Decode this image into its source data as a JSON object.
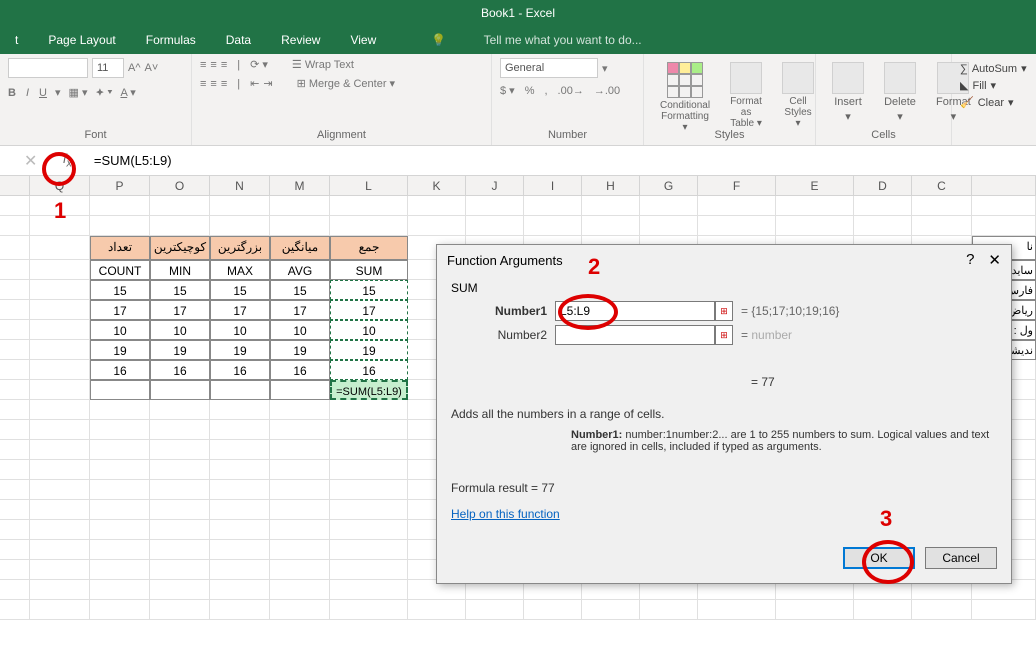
{
  "app": {
    "title": "Book1 - Excel"
  },
  "tabs": {
    "t1": "t",
    "page_layout": "Page Layout",
    "formulas": "Formulas",
    "data": "Data",
    "review": "Review",
    "view": "View",
    "tell_me": "Tell me what you want to do..."
  },
  "ribbon": {
    "font_size": "11",
    "font_group": "Font",
    "alignment_group": "Alignment",
    "wrap_text": "Wrap Text",
    "merge_center": "Merge & Center",
    "number_group": "Number",
    "number_format": "General",
    "styles_group": "Styles",
    "cond_format": "Conditional\nFormatting",
    "format_table": "Format as\nTable",
    "cell_styles": "Cell\nStyles",
    "cells_group": "Cells",
    "insert": "Insert",
    "delete": "Delete",
    "format": "Format",
    "autosum": "AutoSum",
    "fill": "Fill",
    "clear": "Clear"
  },
  "formula_bar": {
    "value": "=SUM(L5:L9)"
  },
  "columns": [
    "Q",
    "P",
    "O",
    "N",
    "M",
    "L",
    "K",
    "J",
    "I",
    "H",
    "G",
    "F",
    "E",
    "D",
    "C"
  ],
  "headers_fa": {
    "count": "تعداد",
    "min": "کوچیکترین",
    "max": "بزرگترین",
    "avg": "میانگین",
    "sum": "جمع"
  },
  "headers_en": {
    "count": "COUNT",
    "min": "MIN",
    "max": "MAX",
    "avg": "AVG",
    "sum": "SUM"
  },
  "data_rows": [
    {
      "p": "15",
      "o": "15",
      "n": "15",
      "m": "15",
      "l": "15"
    },
    {
      "p": "17",
      "o": "17",
      "n": "17",
      "m": "17",
      "l": "17"
    },
    {
      "p": "10",
      "o": "10",
      "n": "10",
      "m": "10",
      "l": "10"
    },
    {
      "p": "19",
      "o": "19",
      "n": "19",
      "m": "19",
      "l": "19"
    },
    {
      "p": "16",
      "o": "16",
      "n": "16",
      "m": "16",
      "l": "16"
    }
  ],
  "sum_formula": "=SUM(L5:L9)",
  "rtl_cells": {
    "r0": "نا",
    "r1": "ساید",
    "r2": "فارس",
    "r3": "رياض",
    "r4": "ول :",
    "r5": "نديشا"
  },
  "dialog": {
    "title": "Function Arguments",
    "func": "SUM",
    "number1_label": "Number1",
    "number1_value": "L5:L9",
    "number1_result": "{15;17;10;19;16}",
    "number2_label": "Number2",
    "number2_result": "number",
    "eq_result": "77",
    "desc": "Adds all the numbers in a range of cells.",
    "detail_label": "Number1:",
    "detail_text": "number:1number:2... are 1 to 255 numbers to sum. Logical values and text are ignored in cells, included if typed as arguments.",
    "formula_result_label": "Formula result =  ",
    "formula_result_value": "77",
    "help": "Help on this function",
    "ok": "OK",
    "cancel": "Cancel"
  },
  "annotations": {
    "n1": "1",
    "n2": "2",
    "n3": "3"
  }
}
